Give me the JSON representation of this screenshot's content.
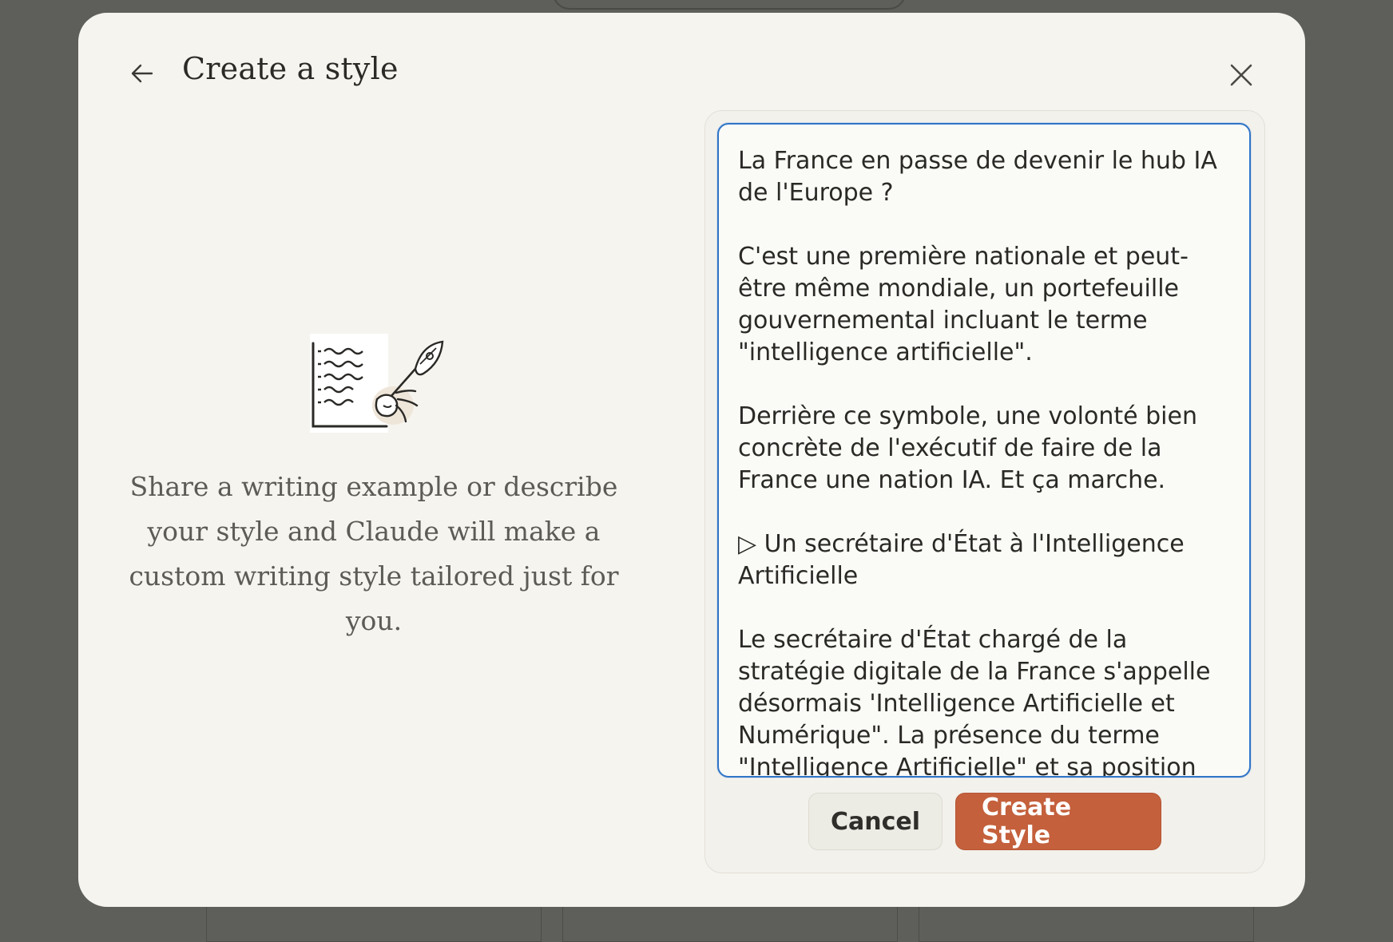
{
  "dialog": {
    "title": "Create a style",
    "back_icon": "arrow-left-icon",
    "close_icon": "close-icon"
  },
  "left": {
    "illustration": "writing-quill-illustration",
    "description": "Share a writing example or describe your style and Claude will make a custom writing style tailored just for you."
  },
  "sample": {
    "value": "La France en passe de devenir le hub IA de l'Europe ?\n\nC'est une première nationale et peut-être même mondiale, un portefeuille gouvernemental incluant le terme \"intelligence artificielle\".\n\nDerrière ce symbole, une volonté bien concrète de l'exécutif de faire de la France une nation IA. Et ça marche.\n\n▷ Un secrétaire d'État à l'Intelligence Artificielle\n\nLe secrétaire d'État chargé de la stratégie digitale de la France s'appelle désormais 'Intelligence Artificielle et Numérique\". La présence du terme \"Intelligence Artificielle\" et sa position"
  },
  "actions": {
    "cancel_label": "Cancel",
    "create_label": "Create Style"
  },
  "colors": {
    "modal_bg": "#f5f4ef",
    "accent": "#c4603c",
    "focus_border": "#2f74c8",
    "overlay": "#5e5e5b"
  }
}
